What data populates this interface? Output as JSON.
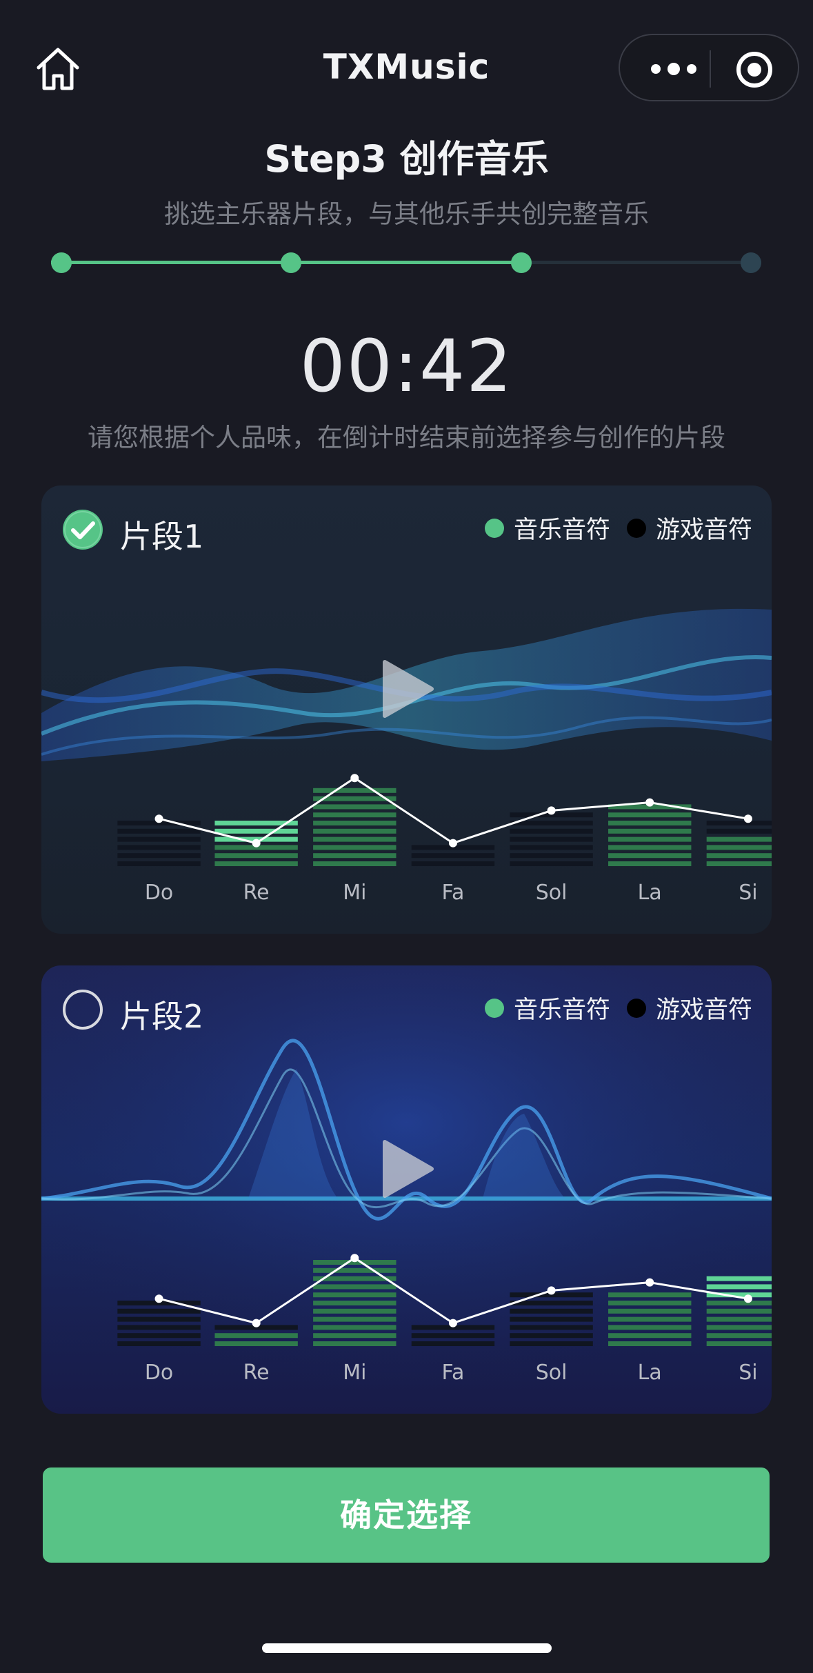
{
  "app": {
    "title": "TXMusic"
  },
  "step": {
    "title": "Step3 创作音乐",
    "subtitle": "挑选主乐器片段，与其他乐手共创完整音乐",
    "progress": {
      "total_steps": 4,
      "completed_steps": 3
    }
  },
  "timer": {
    "value": "00:42",
    "hint": "请您根据个人品味，在倒计时结束前选择参与创作的片段"
  },
  "legend": {
    "music_note": "音乐音符",
    "game_note": "游戏音符"
  },
  "colors": {
    "accent": "#56c487",
    "bar_dim": "#2f7a4c",
    "bar_bright": "#5fd596",
    "bar_dark": "#101520"
  },
  "segments": [
    {
      "name": "片段1",
      "selected": true,
      "notes": [
        "Do",
        "Re",
        "Mi",
        "Fa",
        "Sol",
        "La",
        "Si"
      ],
      "chart_data": {
        "type": "bar",
        "categories": [
          "Do",
          "Re",
          "Mi",
          "Fa",
          "Sol",
          "La",
          "Si"
        ],
        "series": [
          {
            "name": "音乐音符",
            "values": [
              0,
              6,
              10,
              0,
              0,
              8,
              4
            ]
          },
          {
            "name": "游戏音符",
            "values": [
              6,
              0,
              0,
              3,
              7,
              0,
              2
            ]
          }
        ],
        "bright_top": [
          0,
          3,
          0,
          0,
          0,
          0,
          0
        ],
        "line": [
          6,
          3,
          11,
          3,
          7,
          8,
          6
        ],
        "ylim": [
          0,
          12
        ]
      }
    },
    {
      "name": "片段2",
      "selected": false,
      "notes": [
        "Do",
        "Re",
        "Mi",
        "Fa",
        "Sol",
        "La",
        "Si"
      ],
      "chart_data": {
        "type": "bar",
        "categories": [
          "Do",
          "Re",
          "Mi",
          "Fa",
          "Sol",
          "La",
          "Si"
        ],
        "series": [
          {
            "name": "音乐音符",
            "values": [
              0,
              2,
              11,
              0,
              0,
              7,
              9
            ]
          },
          {
            "name": "游戏音符",
            "values": [
              6,
              1,
              0,
              3,
              7,
              0,
              0
            ]
          }
        ],
        "bright_top": [
          0,
          0,
          0,
          0,
          0,
          0,
          3
        ],
        "line": [
          6,
          3,
          11,
          3,
          7,
          8,
          6
        ],
        "ylim": [
          0,
          12
        ]
      }
    }
  ],
  "confirm": {
    "label": "确定选择"
  },
  "icons": {
    "home": "home-icon",
    "more": "more-dots-icon",
    "target": "target-icon",
    "check": "check-circle-icon",
    "play": "play-icon"
  }
}
